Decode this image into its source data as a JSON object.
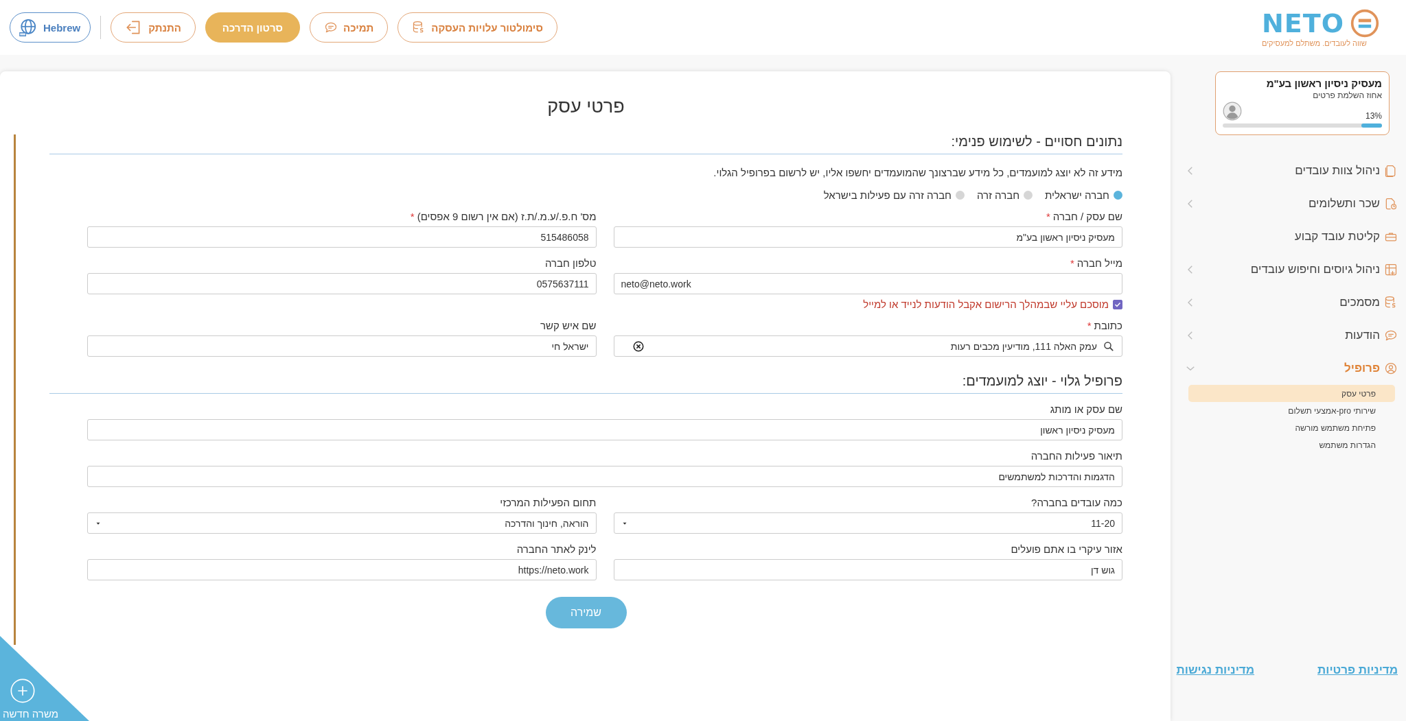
{
  "header": {
    "logo": {
      "wordmark": "NETO",
      "tagline": "שווה לעובדים. משתלם למעסיקים"
    },
    "buttons": [
      {
        "label": "סימולטור עלויות העסקה",
        "kind": "outline"
      },
      {
        "label": "תמיכה",
        "kind": "outline"
      },
      {
        "label": "סרטון הדרכה",
        "kind": "filled"
      },
      {
        "label": "התנתק",
        "kind": "outline"
      },
      {
        "label": "Hebrew",
        "kind": "language"
      }
    ]
  },
  "sidebar": {
    "profile_card": {
      "name": "מעסיק ניסיון ראשון בע\"מ",
      "subtitle": "אחוז השלמת פרטים",
      "percent": "13%",
      "level": 0.13
    },
    "menu": [
      {
        "label": "ניהול צוות עובדים",
        "expanded": false,
        "selected": false
      },
      {
        "label": "שכר ותשלומים",
        "expanded": false,
        "selected": false
      },
      {
        "label": "קליטת עובד קבוע",
        "selected": false
      },
      {
        "label": "ניהול גיוסים וחיפוש עובדים",
        "expanded": false,
        "selected": false
      },
      {
        "label": "מסמכים",
        "expanded": false,
        "selected": false
      },
      {
        "label": "הודעות",
        "expanded": false,
        "selected": false
      },
      {
        "label": "פרופיל",
        "expanded": true,
        "selected": true,
        "children": [
          {
            "label": "פרטי עסק",
            "selected": true
          },
          {
            "label": "שירותי pro-אמצעי תשלום",
            "selected": false
          },
          {
            "label": "פתיחת משתמש מורשה",
            "selected": false
          },
          {
            "label": "הגדרות משתמש",
            "selected": false
          }
        ]
      }
    ],
    "links": [
      "מדיניות פרטיות",
      "מדיניות נגישות"
    ]
  },
  "form": {
    "title": "פרטי עסק",
    "sections": [
      {
        "heading": "נתונים חסויים - לשימוש פנימי:",
        "note": "מידע זה לא יוצג למועמדים, כל מידע שברצונך שהמועמדים יחשפו אליו, יש לרשום בפרופיל הגלוי.",
        "radios": [
          {
            "label": "חברה ישראלית",
            "selected": true
          },
          {
            "label": "חברה זרה",
            "selected": false
          },
          {
            "label": "חברה זרה עם פעילות בישראל",
            "selected": false
          }
        ],
        "fields": [
          {
            "label": "שם עסק / חברה",
            "required_mark": "*",
            "kind": "text",
            "value": "מעסיק ניסיון ראשון בע\"מ"
          },
          {
            "label": "מס' ח.פ./ע.מ./ת.ז (אם אין רשום 9 אפסים)",
            "required_mark": "*",
            "kind": "text",
            "value": "515486058"
          },
          {
            "label": "מייל חברה",
            "required_mark": "*",
            "kind": "email",
            "value": "neto@neto.work",
            "consent": {
              "label": "מוסכם עליי שבמהלך הרישום אקבל הודעות לנייד או למייל",
              "checked": true
            }
          },
          {
            "label": "טלפון חברה",
            "kind": "text",
            "value": "0575637111"
          },
          {
            "label": "כתובת",
            "required_mark": "*",
            "kind": "search",
            "value": "עמק האלה 111, מודיעין מכבים רעות"
          },
          {
            "label": "שם איש קשר",
            "kind": "text",
            "value": "ישראל חי"
          }
        ]
      },
      {
        "heading": "פרופיל גלוי - יוצג למועמדים:",
        "fields": [
          {
            "label": "שם עסק או מותג",
            "kind": "text",
            "value": "מעסיק ניסיון ראשון",
            "full_width": true
          },
          {
            "label": "תיאור פעילות החברה",
            "kind": "text",
            "value": "הדגמות והדרכות למשתמשים",
            "full_width": true
          },
          {
            "label": "כמה עובדים בחברה?",
            "kind": "select",
            "value": "11-20"
          },
          {
            "label": "תחום הפעילות המרכזי",
            "kind": "select",
            "value": "הוראה, חינוך והדרכה"
          },
          {
            "label": "אזור עיקרי בו אתם פועלים",
            "kind": "text",
            "value": "גוש דן"
          },
          {
            "label": "לינק לאתר החברה",
            "kind": "text",
            "value": "https://neto.work"
          }
        ]
      }
    ],
    "save_button": "שמירה"
  },
  "new_job_button": "משרה חדשה"
}
